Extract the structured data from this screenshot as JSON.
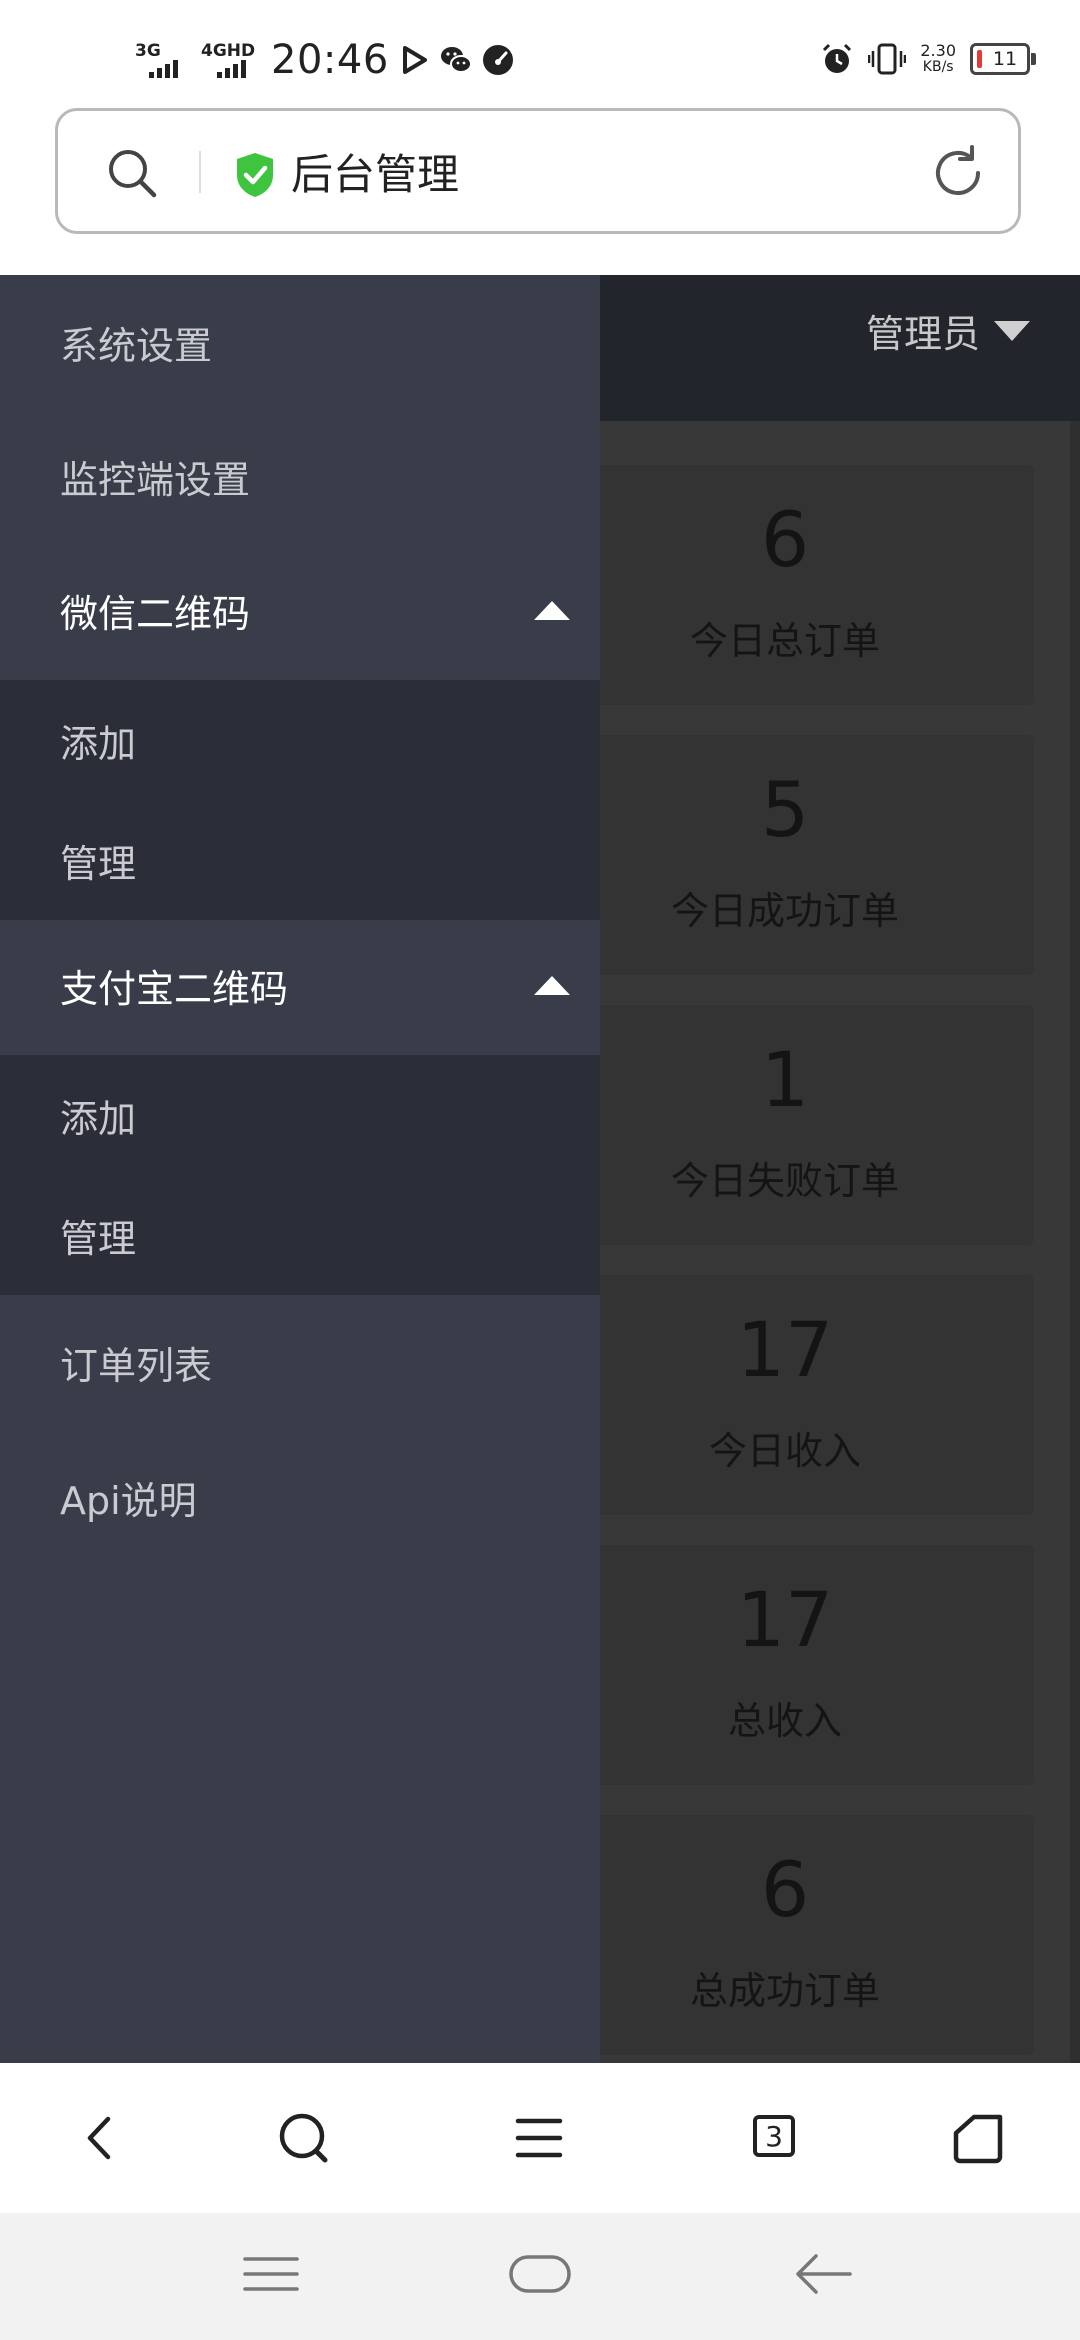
{
  "status_bar": {
    "net1": "3G",
    "net2": "4GHD",
    "time": "20:46",
    "speed_value": "2.30",
    "speed_unit": "KB/s",
    "battery": "11",
    "icons": [
      "play-icon",
      "wechat-icon",
      "speedometer-icon",
      "alarm-icon",
      "vibrate-icon"
    ]
  },
  "url_bar": {
    "title": "后台管理",
    "icons": [
      "search-icon",
      "shield-check-icon",
      "reload-icon"
    ],
    "colors": {
      "shield": "#3fc43f"
    }
  },
  "header": {
    "user_menu": "管理员"
  },
  "stats": [
    {
      "value": "6",
      "label": "今日总订单"
    },
    {
      "value": "5",
      "label": "今日成功订单"
    },
    {
      "value": "1",
      "label": "今日失败订单"
    },
    {
      "value": "17",
      "label": "今日收入"
    },
    {
      "value": "17",
      "label": "总收入"
    },
    {
      "value": "6",
      "label": "总成功订单"
    }
  ],
  "sidebar": {
    "items": [
      {
        "label": "系统设置"
      },
      {
        "label": "监控端设置"
      },
      {
        "label": "微信二维码",
        "expanded": true,
        "children": [
          {
            "label": "添加"
          },
          {
            "label": "管理"
          }
        ]
      },
      {
        "label": "支付宝二维码",
        "expanded": true,
        "children": [
          {
            "label": "添加"
          },
          {
            "label": "管理"
          }
        ]
      },
      {
        "label": "订单列表"
      },
      {
        "label": "Api说明"
      }
    ],
    "colors": {
      "background": "#393d4a",
      "submenu": "#2b2e39"
    }
  },
  "toolbar": {
    "tab_count": "3",
    "icons": [
      "back-icon",
      "search-icon",
      "menu-icon",
      "tabs-icon",
      "home-icon"
    ]
  },
  "system_nav": {
    "icons": [
      "recents-icon",
      "home-pill-icon",
      "back-arrow-icon"
    ]
  }
}
